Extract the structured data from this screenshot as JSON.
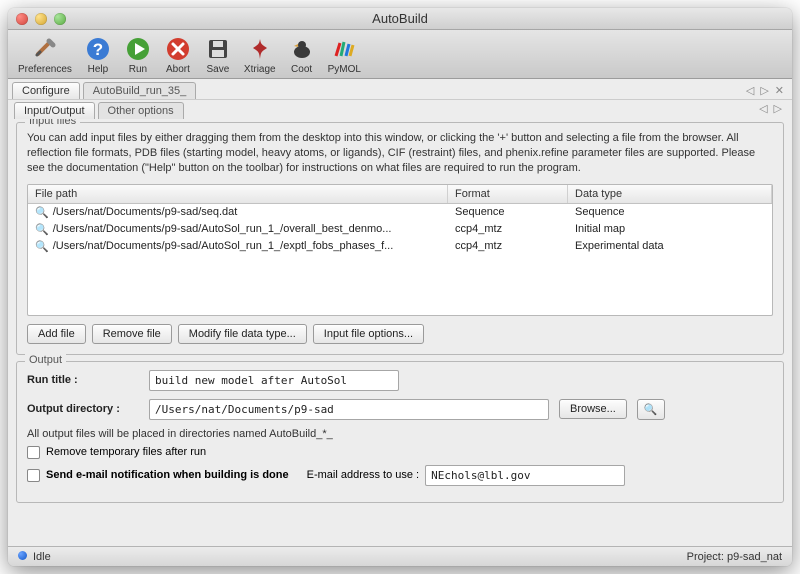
{
  "window": {
    "title": "AutoBuild"
  },
  "toolbar": {
    "preferences": "Preferences",
    "help": "Help",
    "run": "Run",
    "abort": "Abort",
    "save": "Save",
    "xtriage": "Xtriage",
    "coot": "Coot",
    "pymol": "PyMOL"
  },
  "tabs": {
    "configure": "Configure",
    "run35": "AutoBuild_run_35_"
  },
  "subtabs": {
    "io": "Input/Output",
    "other": "Other options"
  },
  "input": {
    "legend": "Input files",
    "help": "You can add input files by either dragging them from the desktop into this window, or clicking the '+' button and selecting a file from the browser. All reflection file formats, PDB files (starting model, heavy atoms, or ligands), CIF (restraint) files, and phenix.refine parameter files are supported.  Please see the documentation (\"Help\" button on the toolbar) for instructions on what files are required to run the program.",
    "headers": {
      "path": "File path",
      "format": "Format",
      "datatype": "Data type"
    },
    "rows": [
      {
        "path": "/Users/nat/Documents/p9-sad/seq.dat",
        "format": "Sequence",
        "datatype": "Sequence"
      },
      {
        "path": "/Users/nat/Documents/p9-sad/AutoSol_run_1_/overall_best_denmo...",
        "format": "ccp4_mtz",
        "datatype": "Initial map"
      },
      {
        "path": "/Users/nat/Documents/p9-sad/AutoSol_run_1_/exptl_fobs_phases_f...",
        "format": "ccp4_mtz",
        "datatype": "Experimental data"
      }
    ],
    "buttons": {
      "add": "Add file",
      "remove": "Remove file",
      "modify": "Modify file data type...",
      "options": "Input file options..."
    }
  },
  "output": {
    "legend": "Output",
    "runtitle_label": "Run title :",
    "runtitle_value": "build new model after AutoSol",
    "outdir_label": "Output directory :",
    "outdir_value": "/Users/nat/Documents/p9-sad",
    "browse": "Browse...",
    "note": "All output files will be placed in directories named AutoBuild_*_",
    "chk_remove": "Remove temporary files after run",
    "chk_email": "Send e-mail notification when building is done",
    "email_label": "E-mail address to use :",
    "email_value": "NEchols@lbl.gov"
  },
  "status": {
    "state": "Idle",
    "project": "Project: p9-sad_nat"
  }
}
